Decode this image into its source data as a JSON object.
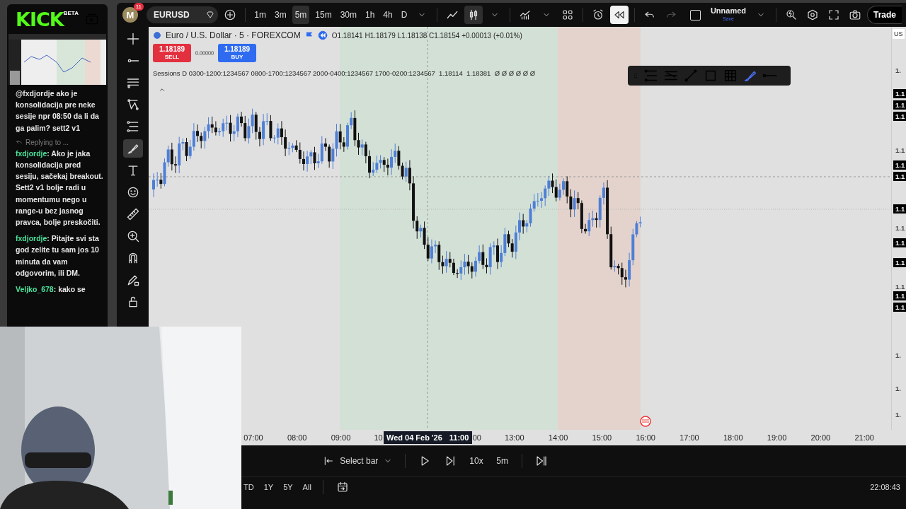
{
  "stream": {
    "logo": "KICK",
    "logo_badge": "BETA"
  },
  "chat": [
    {
      "reply": false,
      "text": "@fxdjordje ako je konsolidacija pre neke sesije npr 08:50 da li da ga palim? sett2 v1"
    },
    {
      "reply": true,
      "reply_text": "Replying to ...",
      "user": "fxdjordje",
      "text": ": Ako je jaka konsolidacija pred sesiju, sačekaj breakout. Sett2 v1 bolje radi u momentumu nego u range-u bez jasnog pravca, bolje preskočiti."
    },
    {
      "reply": false,
      "user": "fxdjordje",
      "text": ": Pitajte svi sta god zelite tu sam jos 10 minuta da vam odgovorim, ili DM."
    },
    {
      "reply": false,
      "user": "Veljko_678",
      "text": ": kako se"
    }
  ],
  "toolbar": {
    "avatar": "M",
    "notifications": "11",
    "symbol": "EURUSD",
    "intervals": [
      {
        "label": "1m",
        "selected": false
      },
      {
        "label": "3m",
        "selected": false
      },
      {
        "label": "5m",
        "selected": true
      },
      {
        "label": "15m",
        "selected": false
      },
      {
        "label": "30m",
        "selected": false
      },
      {
        "label": "1h",
        "selected": false
      },
      {
        "label": "4h",
        "selected": false
      },
      {
        "label": "D",
        "selected": false
      }
    ],
    "candles_selected": true,
    "layout_checked": false,
    "replay_on": true,
    "layout_name": "Unnamed",
    "save": "Save",
    "trade": "Trade"
  },
  "tools": [
    {
      "kind": "crosshair",
      "selected": false
    },
    {
      "kind": "line",
      "selected": false
    },
    {
      "kind": "lines",
      "selected": false
    },
    {
      "kind": "pattern",
      "selected": false
    },
    {
      "kind": "fib",
      "selected": false
    },
    {
      "kind": "brush",
      "selected": true
    },
    {
      "kind": "text",
      "selected": false
    },
    {
      "kind": "emoji",
      "selected": false
    },
    {
      "kind": "ruler",
      "selected": false
    },
    {
      "kind": "zoom",
      "selected": false
    },
    {
      "kind": "magnet",
      "selected": false
    },
    {
      "kind": "pencil-lock",
      "selected": false
    },
    {
      "kind": "lock",
      "selected": false
    }
  ],
  "chart": {
    "title": "Euro / U.S. Dollar · 5 · FOREXCOM",
    "ohlc": "O1.18141 H1.18179 L1.18138 C1.18154 +0.00013 (+0.01%)",
    "sell": {
      "price": "1.18189",
      "label": "SELL"
    },
    "spread": "0.00000",
    "buy": {
      "price": "1.18189",
      "label": "BUY"
    },
    "indicator": "Sessions D 0300-1200:1234567 0800-1700:1234567 2000-0400:1234567 1700-0200:1234567  1.18114  1.18381  Ø Ø Ø Ø Ø Ø",
    "sessions": [
      {
        "color": "#d3e0d6"
      },
      {
        "color": "#e3d3cc"
      }
    ],
    "currency": "US",
    "price_labels": [
      {
        "label": "1.",
        "highlighted": false
      },
      {
        "label": "1.1",
        "highlighted": true
      },
      {
        "label": "1.1",
        "highlighted": true
      },
      {
        "label": "1.1",
        "highlighted": true
      },
      {
        "label": "1.1",
        "highlighted": false
      },
      {
        "label": "1.1",
        "highlighted": true
      },
      {
        "label": "1.1",
        "highlighted": true
      },
      {
        "label": "1.1",
        "highlighted": true
      },
      {
        "label": "1.1",
        "highlighted": false
      },
      {
        "label": "1.1",
        "highlighted": true
      },
      {
        "label": "1.1",
        "highlighted": true
      },
      {
        "label": "1.1",
        "highlighted": false
      },
      {
        "label": "1.1",
        "highlighted": true
      },
      {
        "label": "1.1",
        "highlighted": true
      },
      {
        "label": "1.",
        "highlighted": false
      },
      {
        "label": "1.",
        "highlighted": false
      },
      {
        "label": "1.",
        "highlighted": false
      }
    ],
    "time_axis": [
      {
        "kind": "tick",
        "label": "07:00"
      },
      {
        "kind": "tick",
        "label": "08:00"
      },
      {
        "kind": "tick",
        "label": "09:00"
      },
      {
        "kind": "partial_before",
        "label": "10"
      },
      {
        "kind": "crosshair",
        "date": "Wed 04 Feb '26",
        "time": "11:00"
      },
      {
        "kind": "partial_after",
        "label": "00"
      },
      {
        "kind": "tick",
        "label": "13:00"
      },
      {
        "kind": "tick",
        "label": "14:00"
      },
      {
        "kind": "tick",
        "label": "15:00"
      },
      {
        "kind": "tick",
        "label": "16:00"
      },
      {
        "kind": "tick",
        "label": "17:00"
      },
      {
        "kind": "tick",
        "label": "18:00"
      },
      {
        "kind": "tick",
        "label": "19:00"
      },
      {
        "kind": "tick",
        "label": "20:00"
      },
      {
        "kind": "tick",
        "label": "21:00"
      }
    ]
  },
  "replay": {
    "select_bar": "Select bar",
    "speed": "10x",
    "step": "5m"
  },
  "ranges": [
    "TD",
    "1Y",
    "5Y",
    "All"
  ],
  "clock": "22:08:43"
}
